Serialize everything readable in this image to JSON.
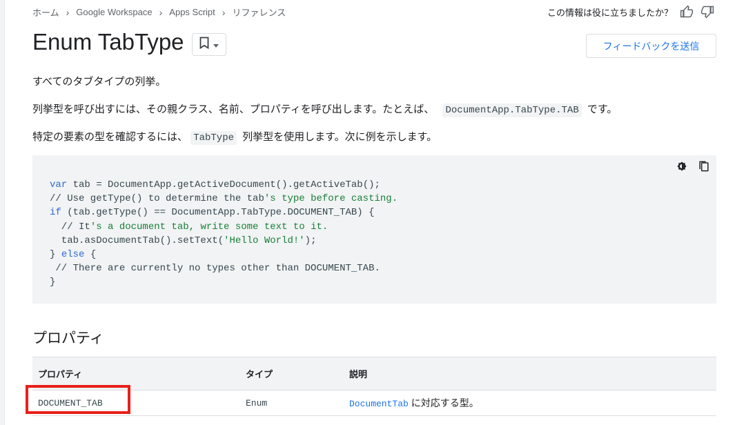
{
  "breadcrumb": {
    "items": [
      "ホーム",
      "Google Workspace",
      "Apps Script",
      "リファレンス"
    ]
  },
  "helpful": {
    "question": "この情報は役に立ちましたか？"
  },
  "header": {
    "title": "Enum TabType",
    "feedback_label": "フィードバックを送信"
  },
  "intro": {
    "line1": "すべてのタブタイプの列挙。",
    "line2_pre": "列挙型を呼び出すには、その親クラス、名前、プロパティを呼び出します。たとえば、",
    "line2_code": "DocumentApp.TabType.TAB",
    "line2_post": "です。",
    "line3_pre": "特定の要素の型を確認するには、",
    "line3_code": "TabType",
    "line3_post": "列挙型を使用します。次に例を示します。"
  },
  "code": {
    "l1_kw": "var",
    "l1_rest": " tab = DocumentApp.getActiveDocument().getActiveTab();",
    "l2_a": "// Use getType() to determine the tab",
    "l2_b": "'s type before casting.",
    "l3_kw": "if",
    "l3_rest": " (tab.getType() == DocumentApp.TabType.DOCUMENT_TAB) {",
    "l4_a": "  // It",
    "l4_b": "'s a document tab, write some text to it.",
    "l5_a": "  tab.asDocumentTab().setText(",
    "l5_str": "'Hello World!'",
    "l5_b": ");",
    "l6_a": "} ",
    "l6_kw": "else",
    "l6_b": " {",
    "l7": " // There are currently no types other than DOCUMENT_TAB.",
    "l8": "}"
  },
  "section": {
    "title": "プロパティ"
  },
  "table": {
    "headers": [
      "プロパティ",
      "タイプ",
      "説明"
    ],
    "rows": [
      {
        "property": "DOCUMENT_TAB",
        "type": "Enum",
        "desc_link": "DocumentTab",
        "desc_rest": " に対応する型。"
      }
    ]
  },
  "colors": {
    "link": "#1a73e8",
    "highlight_box": "#e8201a",
    "code_bg": "#f1f3f4"
  }
}
